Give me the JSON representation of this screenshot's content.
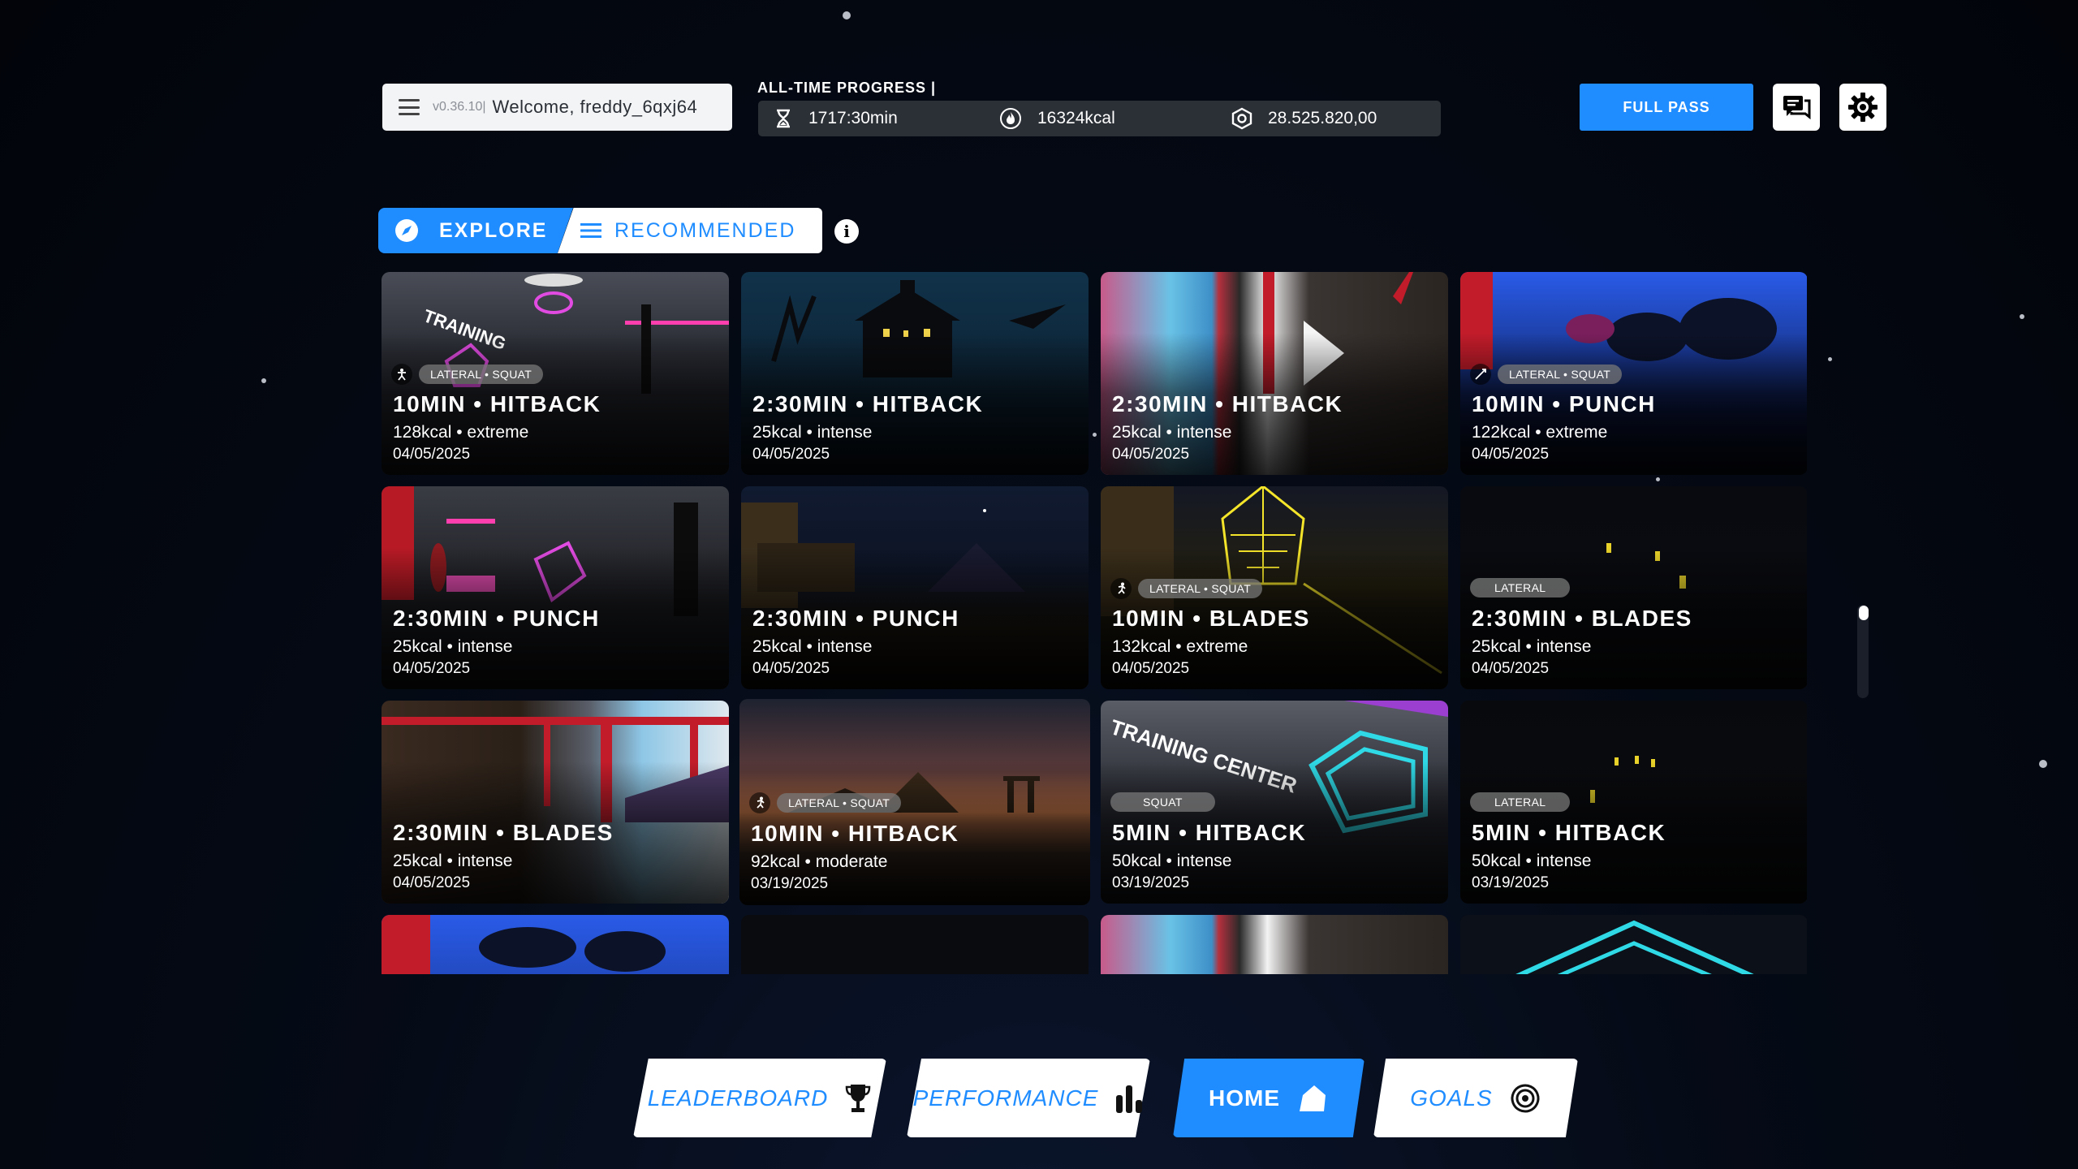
{
  "header": {
    "version": "v0.36.10|",
    "welcome": "Welcome, freddy_6qxj64",
    "progress_title": "ALL-TIME PROGRESS |",
    "stats": {
      "time": "1717:30min",
      "kcal": "16324kcal",
      "points": "28.525.820,00"
    },
    "full_pass_label": "FULL PASS"
  },
  "tabs": {
    "explore": "EXPLORE",
    "recommended": "RECOMMENDED",
    "info": "i"
  },
  "workouts": [
    {
      "title": "10MIN • HITBACK",
      "meta": "128kcal • extreme",
      "date": "04/05/2025",
      "tag": "LATERAL • SQUAT",
      "icon": "figure-icon"
    },
    {
      "title": "2:30MIN • HITBACK",
      "meta": "25kcal • intense",
      "date": "04/05/2025",
      "tag": "",
      "icon": ""
    },
    {
      "title": "2:30MIN • HITBACK",
      "meta": "25kcal • intense",
      "date": "04/05/2025",
      "tag": "",
      "icon": ""
    },
    {
      "title": "10MIN • PUNCH",
      "meta": "122kcal • extreme",
      "date": "04/05/2025",
      "tag": "LATERAL • SQUAT",
      "icon": "figure-icon"
    },
    {
      "title": "2:30MIN • PUNCH",
      "meta": "25kcal • intense",
      "date": "04/05/2025",
      "tag": "",
      "icon": ""
    },
    {
      "title": "2:30MIN • PUNCH",
      "meta": "25kcal • intense",
      "date": "04/05/2025",
      "tag": "",
      "icon": ""
    },
    {
      "title": "10MIN • BLADES",
      "meta": "132kcal • extreme",
      "date": "04/05/2025",
      "tag": "LATERAL • SQUAT",
      "icon": "runner-icon"
    },
    {
      "title": "2:30MIN • BLADES",
      "meta": "25kcal • intense",
      "date": "04/05/2025",
      "tag": "LATERAL",
      "icon": ""
    },
    {
      "title": "2:30MIN • BLADES",
      "meta": "25kcal • intense",
      "date": "04/05/2025",
      "tag": "",
      "icon": ""
    },
    {
      "title": "10MIN • HITBACK",
      "meta": "92kcal • moderate",
      "date": "03/19/2025",
      "tag": "LATERAL • SQUAT",
      "icon": "runner-icon"
    },
    {
      "title": "5MIN • HITBACK",
      "meta": "50kcal • intense",
      "date": "03/19/2025",
      "tag": "SQUAT",
      "icon": ""
    },
    {
      "title": "5MIN • HITBACK",
      "meta": "50kcal • intense",
      "date": "03/19/2025",
      "tag": "LATERAL",
      "icon": ""
    }
  ],
  "nav": {
    "leaderboard": "LEADERBOARD",
    "performance": "PERFORMANCE",
    "home": "HOME",
    "goals": "GOALS"
  },
  "colors": {
    "accent": "#1f8cff",
    "background": "#03060c",
    "stat_bar": "#2b2f36"
  }
}
